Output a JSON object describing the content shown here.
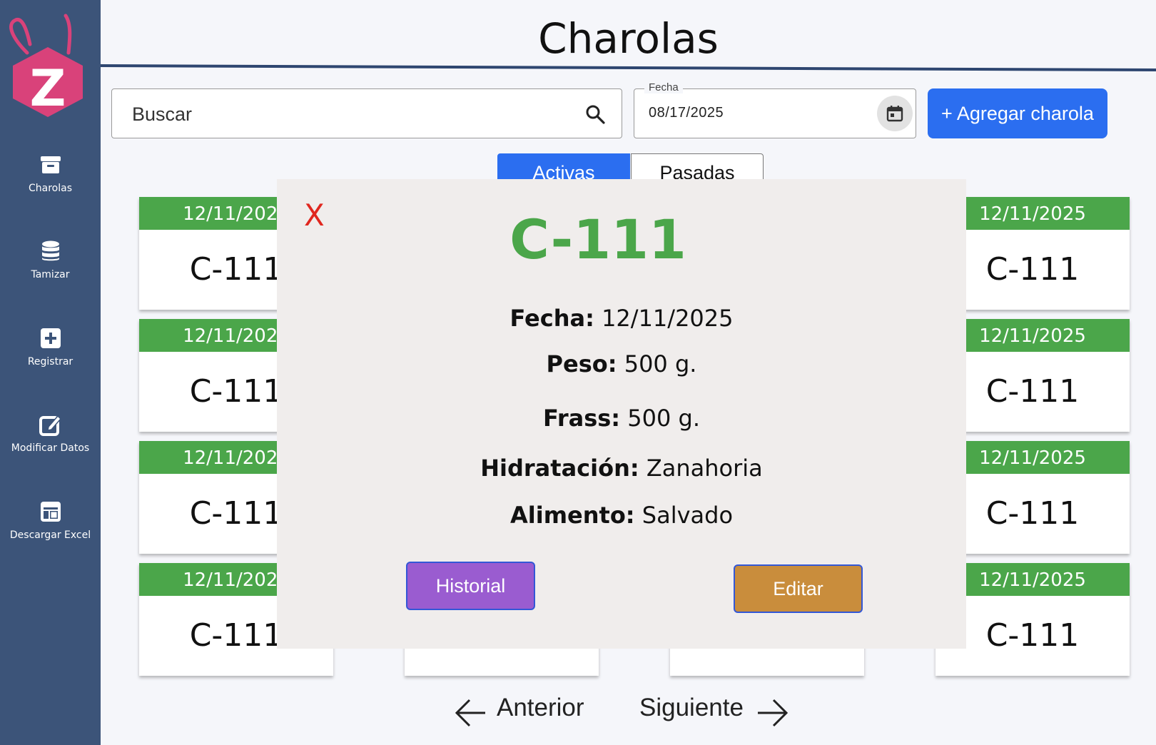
{
  "colors": {
    "sidebar": "#3c5479",
    "accent_blue": "#2b6ef0",
    "card_header_green": "#4ba64a",
    "close_red": "#e0271f",
    "historial_purple": "#9a5cd0",
    "editar_orange": "#c98d3c",
    "logo_pink": "#d9427a"
  },
  "logo": {
    "letter": "Z"
  },
  "sidebar": {
    "items": [
      {
        "label": "Charolas",
        "icon": "archive-icon"
      },
      {
        "label": "Tamizar",
        "icon": "database-icon"
      },
      {
        "label": "Registrar",
        "icon": "plus-square-icon"
      },
      {
        "label": "Modificar Datos",
        "icon": "edit-icon"
      },
      {
        "label": "Descargar Excel",
        "icon": "table-icon"
      }
    ]
  },
  "header": {
    "title": "Charolas"
  },
  "search": {
    "placeholder": "Buscar"
  },
  "date_filter": {
    "label": "Fecha",
    "value": "08/17/2025"
  },
  "add_button": {
    "label": "+ Agregar charola"
  },
  "tabs": {
    "active": "Activas",
    "inactive": "Pasadas"
  },
  "cards": [
    {
      "date": "12/11/2025",
      "name": "C-111"
    },
    {
      "date": "12/11/2025",
      "name": "C-111"
    },
    {
      "date": "12/11/2025",
      "name": "C-111"
    },
    {
      "date": "12/11/2025",
      "name": "C-111"
    },
    {
      "date": "12/11/2025",
      "name": "C-111"
    },
    {
      "date": "12/11/2025",
      "name": "C-111"
    },
    {
      "date": "12/11/2025",
      "name": "C-111"
    },
    {
      "date": "12/11/2025",
      "name": "C-111"
    }
  ],
  "pagination": {
    "prev": "Anterior",
    "next": "Siguiente"
  },
  "modal": {
    "close": "X",
    "title": "C-111",
    "fecha_label": "Fecha:",
    "fecha_value": "12/11/2025",
    "peso_label": "Peso:",
    "peso_value": "500 g.",
    "frass_label": "Frass:",
    "frass_value": "500 g.",
    "hidratacion_label": "Hidratación:",
    "hidratacion_value": "Zanahoria",
    "alimento_label": "Alimento:",
    "alimento_value": "Salvado",
    "historial_button": "Historial",
    "editar_button": "Editar"
  }
}
